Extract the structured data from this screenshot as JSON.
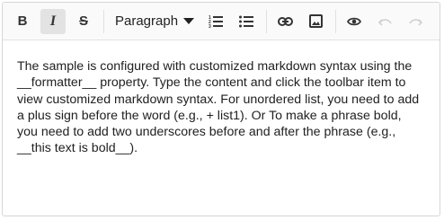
{
  "toolbar": {
    "bold_icon": "bold-icon",
    "italic_icon": "italic-icon",
    "strike_icon": "strikethrough-icon",
    "format_label": "Paragraph",
    "ordered_list_icon": "ordered-list-icon",
    "unordered_list_icon": "unordered-list-icon",
    "link_icon": "link-icon",
    "image_icon": "image-icon",
    "preview_icon": "eye-icon",
    "undo_icon": "undo-icon",
    "redo_icon": "redo-icon"
  },
  "content": {
    "text": "The sample is configured with customized markdown syntax using the __formatter__ property. Type the content and click the toolbar item to view customized markdown syntax. For unordered list, you need to add a plus sign before the word (e.g., + list1). Or To make a phrase bold, you need to add two underscores before and after the phrase (e.g., __this text is bold__)."
  }
}
